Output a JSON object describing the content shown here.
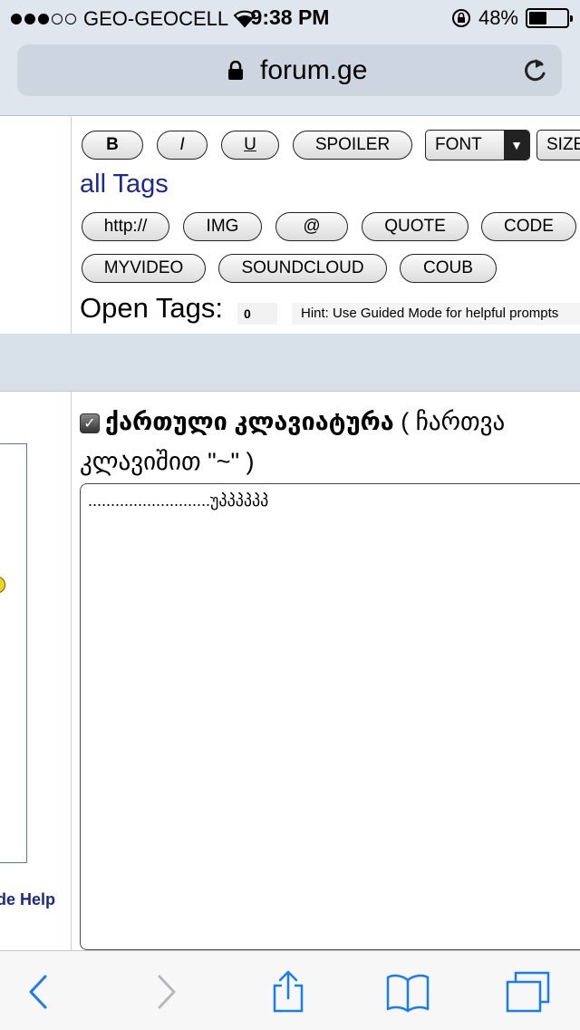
{
  "status_bar": {
    "carrier": "GEO-GEOCELL",
    "time": "9:38 PM",
    "battery": "48%",
    "battery_level": 0.48,
    "signal_bars": 3
  },
  "browser": {
    "url": "forum.ge"
  },
  "editor": {
    "format_buttons": [
      "B",
      "I",
      "U",
      "SPOILER"
    ],
    "font_select": "FONT",
    "size_select": "SIZE",
    "all_tags_label": "all Tags",
    "tag_buttons_row1": [
      "http://",
      "IMG",
      "@",
      "QUOTE",
      "CODE"
    ],
    "tag_buttons_row2": [
      "MYVIDEO",
      "SOUNDCLOUD",
      "COUB"
    ],
    "open_tags_label": "Open Tags:",
    "open_tags_count": "0",
    "hint": "Hint: Use Guided Mode for helpful prompts",
    "keyboard_checkbox_checked": true,
    "keyboard_label_bold": "ქართული კლავიატურა",
    "keyboard_label_rest": " ( ჩართვა",
    "keyboard_label_line2": "კლავიშით \"~\" )",
    "message_text": "...........................უპპპპპპ"
  },
  "sidebar": {
    "guide_help": "de Help"
  },
  "colors": {
    "chrome_bg": "#dfe6ee",
    "link_blue": "#1c2a99",
    "ios_blue": "#1a7cf5"
  }
}
